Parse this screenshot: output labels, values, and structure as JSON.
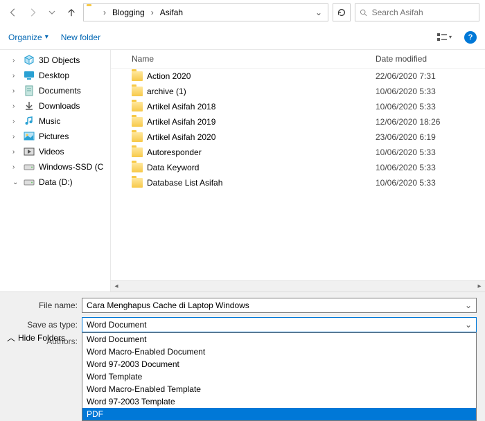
{
  "nav": {
    "path_segments": [
      "Blogging",
      "Asifah"
    ],
    "search_placeholder": "Search Asifah"
  },
  "toolbar": {
    "organize": "Organize",
    "new_folder": "New folder"
  },
  "sidebar": {
    "items": [
      {
        "label": "3D Objects",
        "icon": "cube",
        "color": "#2aa1d3"
      },
      {
        "label": "Desktop",
        "icon": "desktop",
        "color": "#2aa1d3"
      },
      {
        "label": "Documents",
        "icon": "doc",
        "color": "#6aa9a2"
      },
      {
        "label": "Downloads",
        "icon": "download",
        "color": "#555"
      },
      {
        "label": "Music",
        "icon": "music",
        "color": "#2aa1d3"
      },
      {
        "label": "Pictures",
        "icon": "picture",
        "color": "#2aa1d3"
      },
      {
        "label": "Videos",
        "icon": "video",
        "color": "#444"
      },
      {
        "label": "Windows-SSD (C",
        "icon": "drive",
        "color": "#888"
      },
      {
        "label": "Data (D:)",
        "icon": "drive",
        "color": "#888"
      }
    ]
  },
  "columns": {
    "name": "Name",
    "date": "Date modified"
  },
  "files": [
    {
      "name": "Action 2020",
      "date": "22/06/2020 7:31"
    },
    {
      "name": "archive (1)",
      "date": "10/06/2020 5:33"
    },
    {
      "name": "Artikel Asifah 2018",
      "date": "10/06/2020 5:33"
    },
    {
      "name": "Artikel Asifah 2019",
      "date": "12/06/2020 18:26"
    },
    {
      "name": "Artikel Asifah 2020",
      "date": "23/06/2020 6:19"
    },
    {
      "name": "Autoresponder",
      "date": "10/06/2020 5:33"
    },
    {
      "name": "Data Keyword",
      "date": "10/06/2020 5:33"
    },
    {
      "name": "Database List Asifah",
      "date": "10/06/2020 5:33"
    }
  ],
  "form": {
    "filename_label": "File name:",
    "filename_value": "Cara Menghapus Cache di Laptop Windows",
    "savetype_label": "Save as type:",
    "savetype_value": "Word Document",
    "authors_label": "Authors:",
    "hide_folders": "Hide Folders",
    "type_options": [
      "Word Document",
      "Word Macro-Enabled Document",
      "Word 97-2003 Document",
      "Word Template",
      "Word Macro-Enabled Template",
      "Word 97-2003 Template",
      "PDF"
    ],
    "selected_option_index": 6
  }
}
